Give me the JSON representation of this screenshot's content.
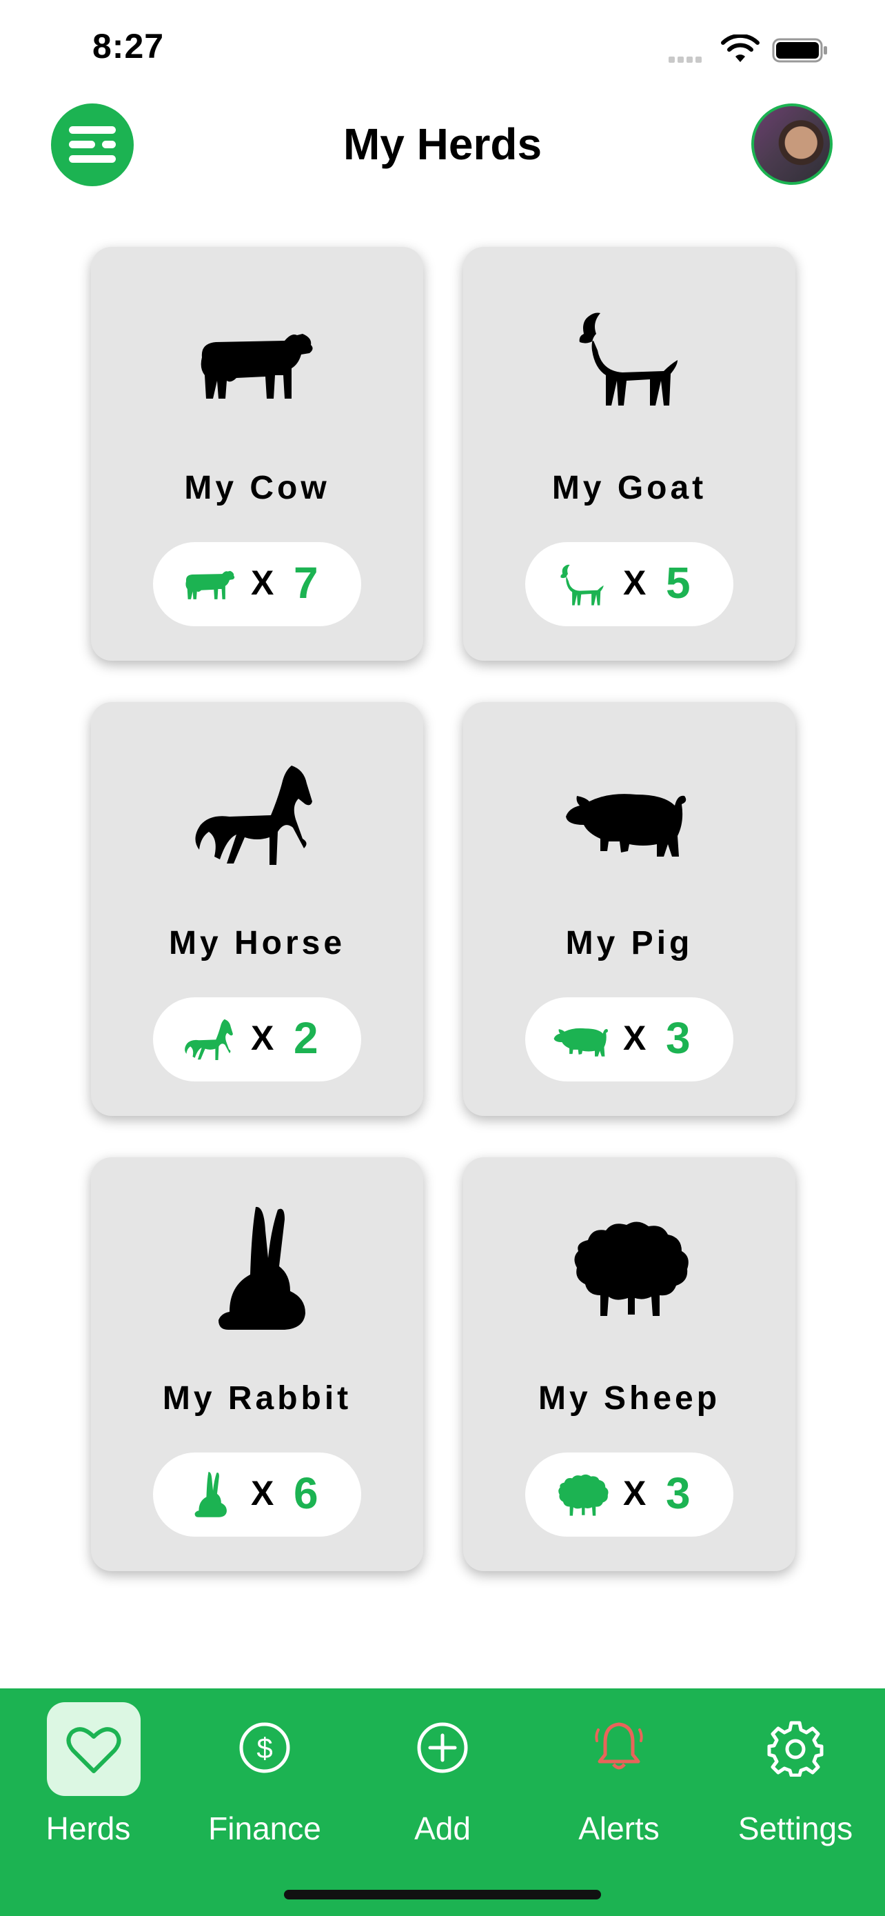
{
  "status_bar": {
    "time": "8:27"
  },
  "header": {
    "title": "My Herds"
  },
  "herds": [
    {
      "label": "My Cow",
      "animal_icon": "cow-icon",
      "multiplier": "X",
      "count": "7"
    },
    {
      "label": "My Goat",
      "animal_icon": "goat-icon",
      "multiplier": "X",
      "count": "5"
    },
    {
      "label": "My Horse",
      "animal_icon": "horse-icon",
      "multiplier": "X",
      "count": "2"
    },
    {
      "label": "My Pig",
      "animal_icon": "pig-icon",
      "multiplier": "X",
      "count": "3"
    },
    {
      "label": "My Rabbit",
      "animal_icon": "rabbit-icon",
      "multiplier": "X",
      "count": "6"
    },
    {
      "label": "My Sheep",
      "animal_icon": "sheep-icon",
      "multiplier": "X",
      "count": "3"
    }
  ],
  "tab_bar": {
    "active": "Herds",
    "items": [
      {
        "label": "Herds",
        "icon": "heart-icon"
      },
      {
        "label": "Finance",
        "icon": "dollar-icon"
      },
      {
        "label": "Add",
        "icon": "plus-circle-icon"
      },
      {
        "label": "Alerts",
        "icon": "bell-icon"
      },
      {
        "label": "Settings",
        "icon": "gear-icon"
      }
    ]
  },
  "colors": {
    "brand_green": "#1cb352",
    "card_background": "#e5e5e5",
    "alert_icon": "#e8645a",
    "active_tab_background": "#dcf7e3"
  }
}
